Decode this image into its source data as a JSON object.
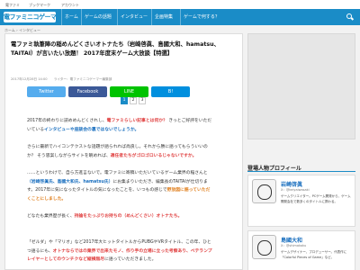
{
  "topstrip": {
    "items": [
      "電ファミ",
      "ブックマーク",
      "アカウント"
    ]
  },
  "header": {
    "logo": "電ファミニコゲーマー",
    "nav": [
      "ホーム",
      "ゲームの話題",
      "インタビュー",
      "企画特集",
      "ゲームで何する？"
    ],
    "search_icon": "search-icon"
  },
  "breadcrumb": "ホーム › インタビュー",
  "article": {
    "title": "電ファミ執筆陣の稲めんどくさいオトナたち（岩崎啓眞、島國大和、hamatsu、TAITAI）が言いたい放題！ 2017年度末ゲーム大放談【特選】",
    "meta": "2017年12月28日 14:00　　ライター：電ファミニコゲーマー編集部",
    "share": {
      "twitter": "Twitter",
      "facebook": "Facebook",
      "line": "LINE",
      "hatena": "B!"
    },
    "pages": [
      "1",
      "2",
      "3"
    ],
    "current_page": "1",
    "p1_pre": "2017年の終わりに読めめんどくされし、",
    "p1_hl": "電ファミらしい記事とは何か？",
    "p1_mid": " きっとご好評をいただいている",
    "p1_hl2": "インタビューや座談会の裏ではないでしょうか。",
    "p2": "さらに最新でハイコンテクストな話題が語られれば尚良し。それから勝に語ってもらういいのか？ そう思案しながらサイトを眺めれば、",
    "p2_hl": "適任者たちがゴロゴロいるじゃないですか。",
    "p3_pre": "……というわけで、自ら方進言ないで。電ファミに寄稿いただいているゲーム業界の稲さんと",
    "p3_names": "（岩崎啓眞氏、島國大和氏、hamatsu氏）",
    "p3_post": "にお集まりいただき、編集長のTAITAIが仕切ります。2017年に気になったタイトルの気になったことを、いつもの感じで",
    "p3_hl": "野放図に語っていただくことにしました。",
    "p4_pre": "どなたも業界歴が長く、",
    "p4_hl": "持論をたっぷりお持ちの（めんどくさい）オトナたち。",
    "p5": "「ゼルダ」や「マリオ」など2017年大ヒットタイトルからPUBGやVRタイトル、この年、ひとつ語るにも、",
    "p5_hl": "オトナならではの業界で出来たモノ、作り手の立場に立った考察あり、ベテランプレイヤーとしてのウンチクなど縦横無尽",
    "p5_post": "に語っていただきました。"
  },
  "sidebar": {
    "ad_label": "",
    "heading": "登場人物プロフィール",
    "people": [
      {
        "name": "岩崎啓眞",
        "link": "X：@keiyaiwasaki",
        "bio": "ゲームクリエイター。PCゲーム開発から、ゲーム開発会社で数多くのタイトルに携わる。"
      },
      {
        "name": "島國大和",
        "link": "X：@shimakoku",
        "bio": "ゲームデザイナー、プロデューサー。代表作に「Colorful Pieces of Game」など。"
      }
    ]
  },
  "colors": {
    "brand": "#1a8cc7",
    "twitter": "#55acee",
    "facebook": "#3b5998",
    "line": "#00c300",
    "hatena": "#008fde",
    "highlight_red": "#e04040"
  }
}
